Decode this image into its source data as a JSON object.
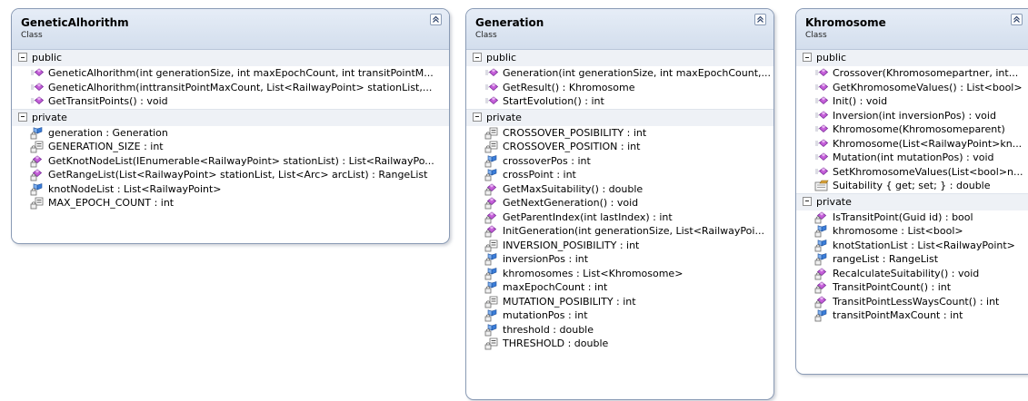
{
  "classes": [
    {
      "name": "GeneticAlhorithm",
      "kind": "Class",
      "sections": [
        {
          "label": "public",
          "members": [
            {
              "icon": "public-method-icon",
              "text": "GeneticAlhorithm(int generationSize, int maxEpochCount, int transitPointM..."
            },
            {
              "icon": "public-method-icon",
              "text": "GeneticAlhorithm(inttransitPointMaxCount, List<RailwayPoint> stationList,..."
            },
            {
              "icon": "public-method-icon",
              "text": "GetTransitPoints() : void"
            }
          ]
        },
        {
          "label": "private",
          "members": [
            {
              "icon": "private-field-icon",
              "text": "generation : Generation"
            },
            {
              "icon": "private-constant-icon",
              "text": "GENERATION_SIZE : int"
            },
            {
              "icon": "private-method-icon",
              "text": "GetKnotNodeList(IEnumerable<RailwayPoint> stationList) : List<RailwayPo..."
            },
            {
              "icon": "private-method-icon",
              "text": "GetRangeList(List<RailwayPoint> stationList, List<Arc> arcList) : RangeList"
            },
            {
              "icon": "private-field-icon",
              "text": "knotNodeList : List<RailwayPoint>"
            },
            {
              "icon": "private-constant-icon",
              "text": "MAX_EPOCH_COUNT : int"
            }
          ]
        }
      ]
    },
    {
      "name": "Generation",
      "kind": "Class",
      "sections": [
        {
          "label": "public",
          "members": [
            {
              "icon": "public-method-icon",
              "text": "Generation(int generationSize, int maxEpochCount,..."
            },
            {
              "icon": "public-method-icon",
              "text": "GetResult() : Khromosome"
            },
            {
              "icon": "public-method-icon",
              "text": "StartEvolution() : int"
            }
          ]
        },
        {
          "label": "private",
          "members": [
            {
              "icon": "private-constant-icon",
              "text": "CROSSOVER_POSIBILITY : int"
            },
            {
              "icon": "private-constant-icon",
              "text": "CROSSOVER_POSITION : int"
            },
            {
              "icon": "private-field-icon",
              "text": "crossoverPos : int"
            },
            {
              "icon": "private-field-icon",
              "text": "crossPoint : int"
            },
            {
              "icon": "private-method-icon",
              "text": "GetMaxSuitability() : double"
            },
            {
              "icon": "private-method-icon",
              "text": "GetNextGeneration() : void"
            },
            {
              "icon": "private-method-icon",
              "text": "GetParentIndex(int lastIndex) : int"
            },
            {
              "icon": "private-method-icon",
              "text": "InitGeneration(int generationSize, List<RailwayPoi..."
            },
            {
              "icon": "private-constant-icon",
              "text": "INVERSION_POSIBILITY : int"
            },
            {
              "icon": "private-field-icon",
              "text": "inversionPos : int"
            },
            {
              "icon": "private-field-icon",
              "text": "khromosomes : List<Khromosome>"
            },
            {
              "icon": "private-field-icon",
              "text": "maxEpochCount : int"
            },
            {
              "icon": "private-constant-icon",
              "text": "MUTATION_POSIBILITY : int"
            },
            {
              "icon": "private-field-icon",
              "text": "mutationPos : int"
            },
            {
              "icon": "private-field-icon",
              "text": "threshold : double"
            },
            {
              "icon": "private-constant-icon",
              "text": "THRESHOLD : double"
            }
          ]
        }
      ]
    },
    {
      "name": "Khromosome",
      "kind": "Class",
      "sections": [
        {
          "label": "public",
          "members": [
            {
              "icon": "public-method-icon",
              "text": "Crossover(Khromosomepartner, int..."
            },
            {
              "icon": "public-method-icon",
              "text": "GetKhromosomeValues() : List<bool>"
            },
            {
              "icon": "public-method-icon",
              "text": "Init() : void"
            },
            {
              "icon": "public-method-icon",
              "text": "Inversion(int inversionPos) : void"
            },
            {
              "icon": "public-method-icon",
              "text": "Khromosome(Khromosomeparent)"
            },
            {
              "icon": "public-method-icon",
              "text": "Khromosome(List<RailwayPoint>kn..."
            },
            {
              "icon": "public-method-icon",
              "text": "Mutation(int mutationPos) : void"
            },
            {
              "icon": "public-method-icon",
              "text": "SetKhromosomeValues(List<bool>n..."
            },
            {
              "icon": "public-property-icon",
              "text": "Suitability { get; set; } : double"
            }
          ]
        },
        {
          "label": "private",
          "members": [
            {
              "icon": "private-method-icon",
              "text": "IsTransitPoint(Guid id) : bool"
            },
            {
              "icon": "private-field-icon",
              "text": "khromosome : List<bool>"
            },
            {
              "icon": "private-field-icon",
              "text": "knotStationList : List<RailwayPoint>"
            },
            {
              "icon": "private-field-icon",
              "text": "rangeList : RangeList"
            },
            {
              "icon": "private-method-icon",
              "text": "RecalculateSuitability() : void"
            },
            {
              "icon": "private-method-icon",
              "text": "TransitPointCount() : int"
            },
            {
              "icon": "private-method-icon",
              "text": "TransitPointLessWaysCount() : int"
            },
            {
              "icon": "private-field-icon",
              "text": "transitPointMaxCount : int"
            }
          ]
        }
      ]
    }
  ]
}
